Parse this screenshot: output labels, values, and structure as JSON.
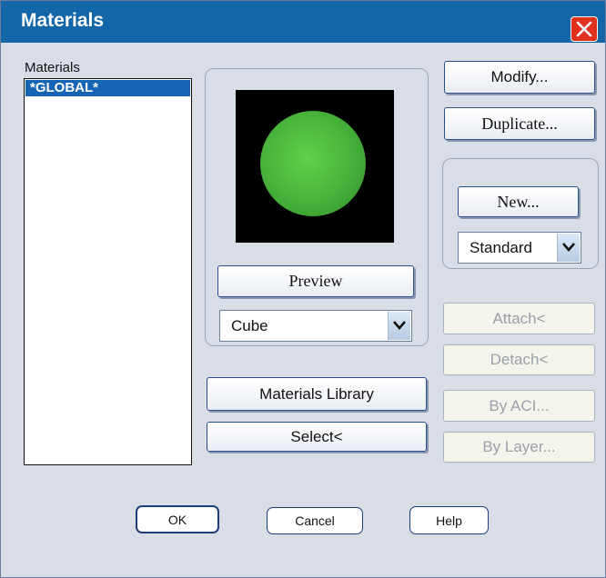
{
  "window": {
    "title": "Materials"
  },
  "materials_list": {
    "label": "Materials",
    "items": [
      "*GLOBAL*"
    ]
  },
  "preview": {
    "button_label": "Preview",
    "shape_select": {
      "value": "Cube"
    }
  },
  "center_buttons": {
    "materials_library": "Materials Library",
    "select": "Select<"
  },
  "right_buttons": {
    "modify": "Modify...",
    "duplicate": "Duplicate...",
    "new": "New...",
    "type_select": {
      "value": "Standard"
    },
    "attach": "Attach<",
    "detach": "Detach<",
    "by_aci": "By ACI...",
    "by_layer": "By Layer..."
  },
  "footer": {
    "ok": "OK",
    "cancel": "Cancel",
    "help": "Help"
  },
  "colors": {
    "titlebar": "#1366a8",
    "selection": "#1565b4",
    "close": "#e0301e",
    "dialog_bg": "#d9dde6"
  }
}
